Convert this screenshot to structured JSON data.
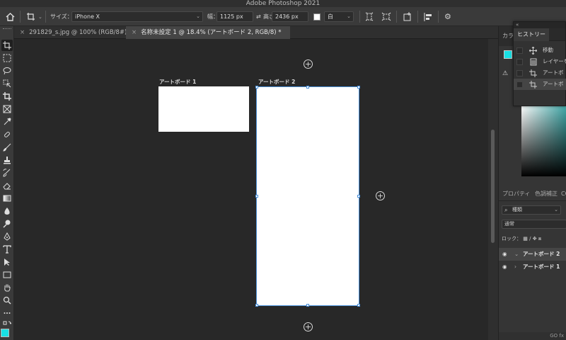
{
  "app": {
    "title": "Adobe Photoshop 2021"
  },
  "options": {
    "size_label": "サイズ：",
    "size_value": "iPhone X",
    "width_label": "幅：",
    "width_value": "1125 px",
    "height_label": "高さ：",
    "height_value": "2436 px",
    "fill_value": "白"
  },
  "tabs": [
    {
      "close": "×",
      "label": "291829_s.jpg @ 100% (RGB/8#)"
    },
    {
      "close": "×",
      "label": "名称未設定 1 @ 18.4% (アートボード 2, RGB/8) *"
    }
  ],
  "canvas": {
    "artboard1_label": "アートボード 1",
    "artboard2_label": "アートボード 2",
    "plus": "+"
  },
  "color_panel": {
    "tab_label": "カラ",
    "warning": "⚠"
  },
  "history": {
    "header": "«",
    "tab_label": "ヒストリー",
    "rows": [
      {
        "label": "移動",
        "icon": "move-icon"
      },
      {
        "label": "レイヤーを",
        "icon": "layer-icon"
      },
      {
        "label": "アートボ",
        "icon": "artboard-icon"
      },
      {
        "label": "アートボ",
        "icon": "artboard-icon"
      }
    ]
  },
  "properties": {
    "tabs": [
      "プロパティ",
      "色調補正",
      "CC"
    ]
  },
  "layers": {
    "search_label": "種類",
    "blend_mode": "通常",
    "lock_label": "ロック：",
    "items": [
      {
        "name": "アートボード 2",
        "expanded": true,
        "selected": true
      },
      {
        "name": "アートボード 1",
        "expanded": false,
        "selected": false
      }
    ],
    "bottom_icons": "GO fx"
  },
  "colors": {
    "foreground": "#18e0e4",
    "background": "#ffffff",
    "accent": "#4a90d9"
  }
}
